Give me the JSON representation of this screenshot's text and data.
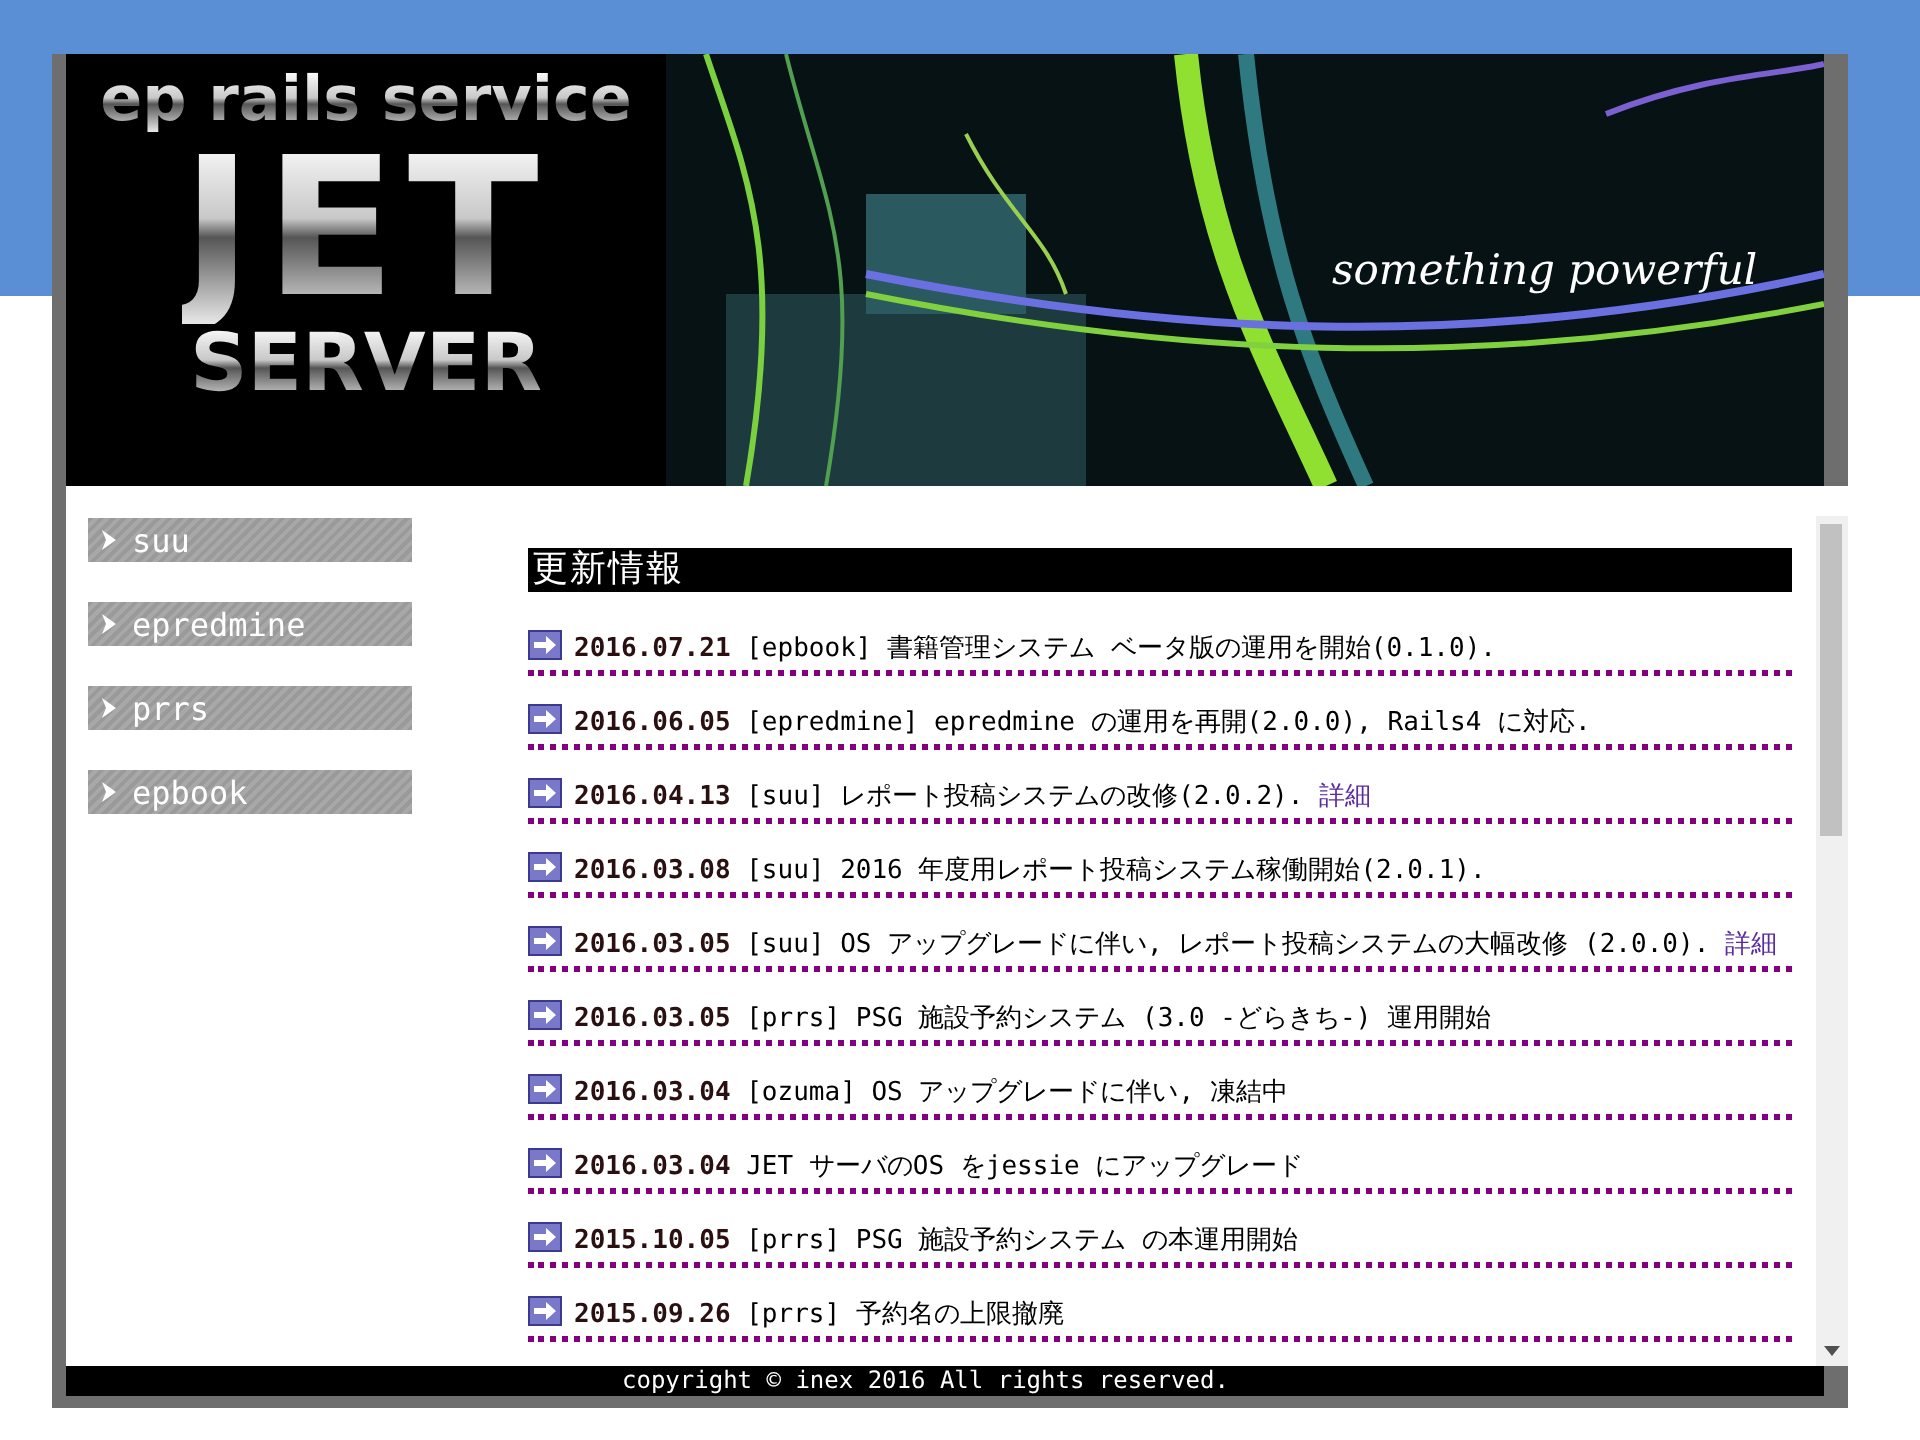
{
  "banner": {
    "logo_lines": [
      "ep rails service",
      "JET",
      "SERVER"
    ],
    "tagline": "something powerful"
  },
  "sidebar": {
    "items": [
      {
        "label": "suu"
      },
      {
        "label": "epredmine"
      },
      {
        "label": "prrs"
      },
      {
        "label": "epbook"
      }
    ]
  },
  "news": {
    "heading": "更新情報",
    "items": [
      {
        "date": "2016.07.21",
        "text": "[epbook] 書籍管理システム ベータ版の運用を開始(0.1.0)."
      },
      {
        "date": "2016.06.05",
        "text": "[epredmine] epredmine の運用を再開(2.0.0), Rails4 に対応."
      },
      {
        "date": "2016.04.13",
        "text": "[suu] レポート投稿システムの改修(2.0.2).",
        "link": "詳細"
      },
      {
        "date": "2016.03.08",
        "text": "[suu] 2016 年度用レポート投稿システム稼働開始(2.0.1)."
      },
      {
        "date": "2016.03.05",
        "text": "[suu] OS アップグレードに伴い, レポート投稿システムの大幅改修 (2.0.0).",
        "link": "詳細"
      },
      {
        "date": "2016.03.05",
        "text": "[prrs] PSG 施設予約システム (3.0 -どらきち-) 運用開始"
      },
      {
        "date": "2016.03.04",
        "text": "[ozuma] OS アップグレードに伴い, 凍結中"
      },
      {
        "date": "2016.03.04",
        "text": "JET サーバのOS をjessie にアップグレード"
      },
      {
        "date": "2015.10.05",
        "text": "[prrs] PSG 施設予約システム の本運用開始"
      },
      {
        "date": "2015.09.26",
        "text": "[prrs] 予約名の上限撤廃"
      }
    ]
  },
  "footer": {
    "text": "copyright © inex 2016 All rights reserved."
  }
}
